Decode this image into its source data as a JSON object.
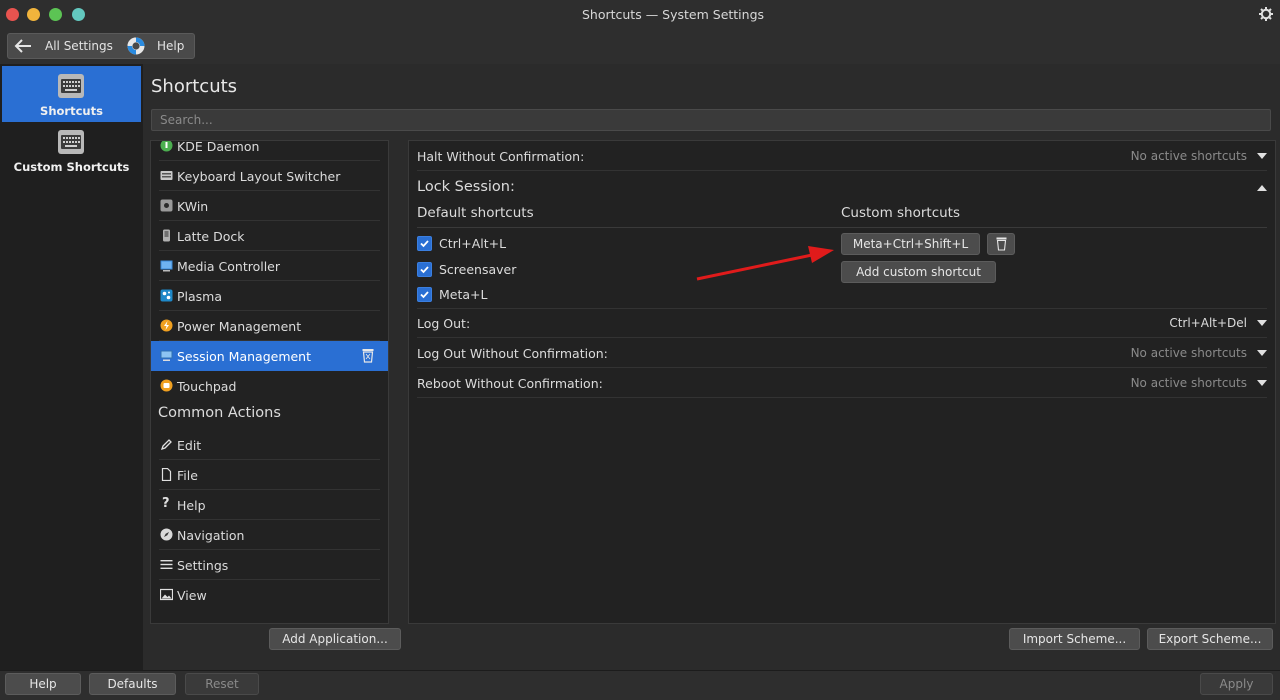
{
  "window": {
    "title": "Shortcuts — System Settings",
    "traffic_colors": [
      "#e8534f",
      "#f1b43c",
      "#5cc454",
      "#63c8bf"
    ]
  },
  "toolbar": {
    "back_label": "All Settings",
    "help_label": "Help"
  },
  "sidebar": {
    "items": [
      {
        "label": "Shortcuts",
        "icon": "keyboard-icon",
        "active": true
      },
      {
        "label": "Custom Shortcuts",
        "icon": "keyboard-icon",
        "active": false
      }
    ]
  },
  "page": {
    "title": "Shortcuts",
    "search_placeholder": "Search..."
  },
  "components": {
    "items": [
      {
        "label": "KDE Daemon",
        "icon": "kde-daemon-icon"
      },
      {
        "label": "Keyboard Layout Switcher",
        "icon": "keyboard-layout-icon"
      },
      {
        "label": "KWin",
        "icon": "kwin-icon"
      },
      {
        "label": "Latte Dock",
        "icon": "latte-dock-icon"
      },
      {
        "label": "Media Controller",
        "icon": "media-controller-icon"
      },
      {
        "label": "Plasma",
        "icon": "plasma-icon"
      },
      {
        "label": "Power Management",
        "icon": "power-icon"
      },
      {
        "label": "Session Management",
        "icon": "session-icon",
        "selected": true
      },
      {
        "label": "Touchpad",
        "icon": "touchpad-icon"
      }
    ],
    "common_actions_heading": "Common Actions",
    "common_actions": [
      {
        "label": "Edit",
        "icon": "pencil-icon"
      },
      {
        "label": "File",
        "icon": "file-icon"
      },
      {
        "label": "Help",
        "icon": "question-icon"
      },
      {
        "label": "Navigation",
        "icon": "compass-icon"
      },
      {
        "label": "Settings",
        "icon": "hamburger-icon"
      },
      {
        "label": "View",
        "icon": "image-icon"
      }
    ],
    "add_application_label": "Add Application..."
  },
  "detail": {
    "rows_before": [
      {
        "name": "Halt Without Confirmation:",
        "value": "No active shortcuts"
      }
    ],
    "expanded": {
      "name": "Lock Session:",
      "default_heading": "Default shortcuts",
      "custom_heading": "Custom shortcuts",
      "defaults": [
        "Ctrl+Alt+L",
        "Screensaver",
        "Meta+L"
      ],
      "custom_shortcut": "Meta+Ctrl+Shift+L",
      "add_custom_label": "Add custom shortcut"
    },
    "rows_after": [
      {
        "name": "Log Out:",
        "value": "Ctrl+Alt+Del",
        "active": true
      },
      {
        "name": "Log Out Without Confirmation:",
        "value": "No active shortcuts"
      },
      {
        "name": "Reboot Without Confirmation:",
        "value": "No active shortcuts"
      }
    ]
  },
  "scheme": {
    "import_label": "Import Scheme...",
    "export_label": "Export Scheme..."
  },
  "bottom": {
    "help_label": "Help",
    "defaults_label": "Defaults",
    "reset_label": "Reset",
    "apply_label": "Apply"
  },
  "colors": {
    "accent": "#2a6fd3",
    "annotation_arrow": "#e01b1b"
  }
}
